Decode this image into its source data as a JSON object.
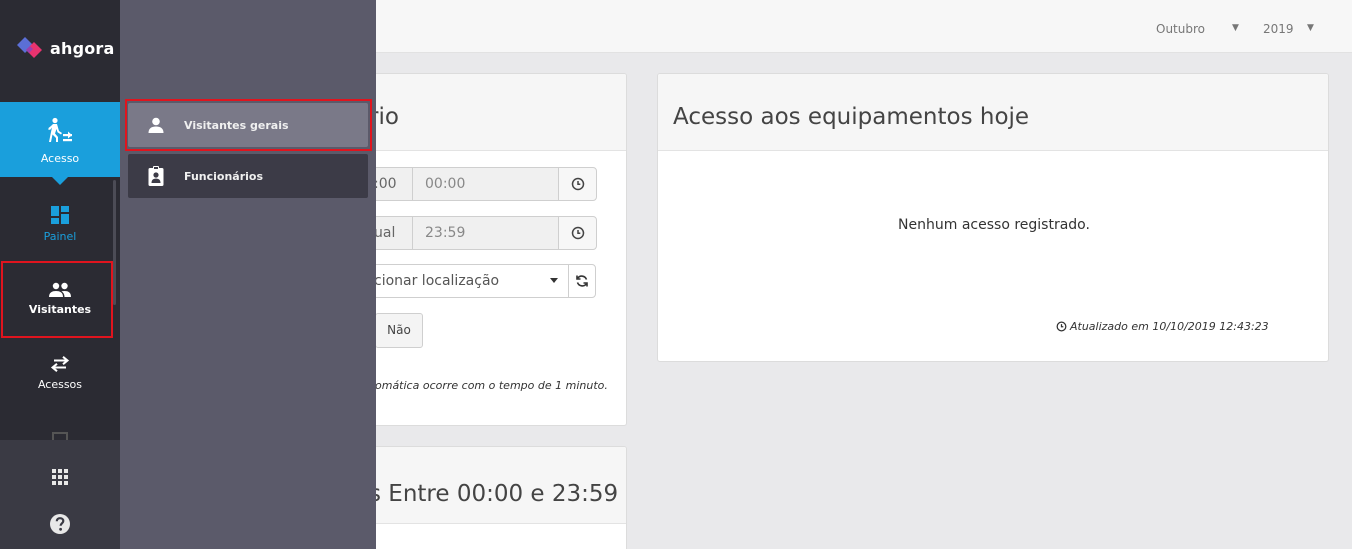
{
  "topbar": {
    "month": "Outubro",
    "year": "2019"
  },
  "sidebar": {
    "brand": "ahgora",
    "items": [
      {
        "label": "Acesso",
        "icon": "access-walk-icon"
      },
      {
        "label": "Painel",
        "icon": "dashboard-grid-icon"
      },
      {
        "label": "Visitantes",
        "icon": "people-icon"
      },
      {
        "label": "Acessos",
        "icon": "swap-arrows-icon"
      }
    ],
    "bottom": {
      "apps_icon": "apps-grid-icon",
      "help_icon": "help-circle-icon"
    }
  },
  "submenu": {
    "items": [
      {
        "label": "Visitantes gerais",
        "icon": "person-icon"
      },
      {
        "label": "Funcionários",
        "icon": "badge-icon"
      }
    ]
  },
  "left_card": {
    "title_partial": "rio",
    "start_time_partial": ":00",
    "start_time": "00:00",
    "end_label_partial": "ual",
    "end_time": "23:59",
    "location_partial": "cionar localização",
    "no_button": "Não",
    "note_partial": "omática ocorre com o tempo de 1 minuto."
  },
  "bottom_card": {
    "title_partial": "s Entre 00:00 e 23:59"
  },
  "right_card": {
    "title": "Acesso aos equipamentos hoje",
    "empty_message": "Nenhum acesso registrado.",
    "updated_text": "Atualizado em 10/10/2019 12:43:23"
  },
  "colors": {
    "accent": "#1a9fdc",
    "highlight": "#e0141e",
    "sidebar": "#2b2b33",
    "submenu": "#5b5a6a"
  }
}
